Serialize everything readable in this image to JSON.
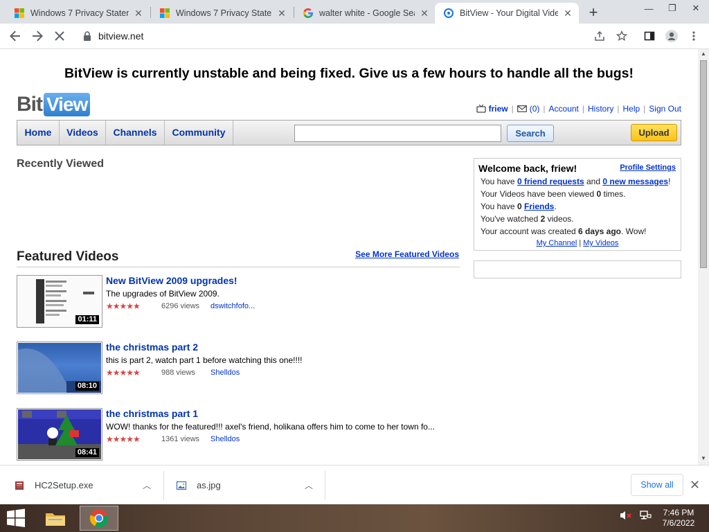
{
  "browser": {
    "tabs": [
      {
        "title": "Windows 7 Privacy Statem",
        "icon": "microsoft-icon"
      },
      {
        "title": "Windows 7 Privacy Statem",
        "icon": "microsoft-icon"
      },
      {
        "title": "walter white - Google Sear",
        "icon": "google-icon"
      },
      {
        "title": "BitView - Your Digital Vide",
        "icon": "bitview-icon",
        "active": true
      }
    ],
    "url": "bitview.net"
  },
  "page": {
    "banner": "BitView is currently unstable and being fixed. Give us a few hours to handle all the bugs!",
    "logo": {
      "part1": "Bit",
      "part2": "View"
    },
    "user": {
      "username": "friew",
      "inbox_count": "(0)",
      "links": [
        "Account",
        "History",
        "Help",
        "Sign Out"
      ]
    },
    "nav": {
      "items": [
        "Home",
        "Videos",
        "Channels",
        "Community"
      ],
      "search_label": "Search",
      "search_value": "",
      "upload_label": "Upload"
    },
    "recently_viewed_title": "Recently Viewed",
    "featured": {
      "title": "Featured Videos",
      "more_link": "See More Featured Videos",
      "videos": [
        {
          "title": "New BitView 2009 upgrades!",
          "description": "The upgrades of BitView 2009.",
          "views": "6296 views",
          "author": "dswitchfofo...",
          "duration": "01:11",
          "rating": 4.5
        },
        {
          "title": "the christmas part 2",
          "description": "this is part 2, watch part 1 before watching this one!!!!",
          "views": "988 views",
          "author": "Shelldos",
          "duration": "08:10",
          "rating": 4.5
        },
        {
          "title": "the christmas part 1",
          "description": "WOW! thanks for the featured!!! axel's friend, holikana offers him to come to her town fo...",
          "views": "1361 views",
          "author": "Shelldos",
          "duration": "08:41",
          "rating": 4.5
        }
      ]
    },
    "profile": {
      "welcome": "Welcome back, friew!",
      "settings_link": "Profile Settings",
      "line1_pre": "You have ",
      "friend_requests": "0 friend requests",
      "line1_mid": " and ",
      "new_messages": "0 new messages",
      "line1_post": "!",
      "line2_pre": "Your Videos have been viewed ",
      "views_count": "0",
      "line2_post": " times.",
      "line3_pre": "You have ",
      "friends_count": "0",
      "friends_link": "Friends",
      "line3_post": ".",
      "line4_pre": "You've watched ",
      "watched_count": "2",
      "line4_post": " videos.",
      "line5_pre": "Your account was created ",
      "created_ago": "6 days ago",
      "line5_post": ". Wow!",
      "my_channel": "My Channel",
      "my_videos": "My Videos",
      "link_sep": "|"
    }
  },
  "downloads": {
    "items": [
      {
        "name": "HC2Setup.exe",
        "icon": "installer-icon"
      },
      {
        "name": "as.jpg",
        "icon": "image-file-icon"
      }
    ],
    "show_all": "Show all"
  },
  "taskbar": {
    "time": "7:46 PM",
    "date": "7/6/2022"
  },
  "colors": {
    "link": "#0033cc",
    "nav_text": "#0033aa",
    "upload_bg": "#fbc21a",
    "star": "#d64545"
  }
}
